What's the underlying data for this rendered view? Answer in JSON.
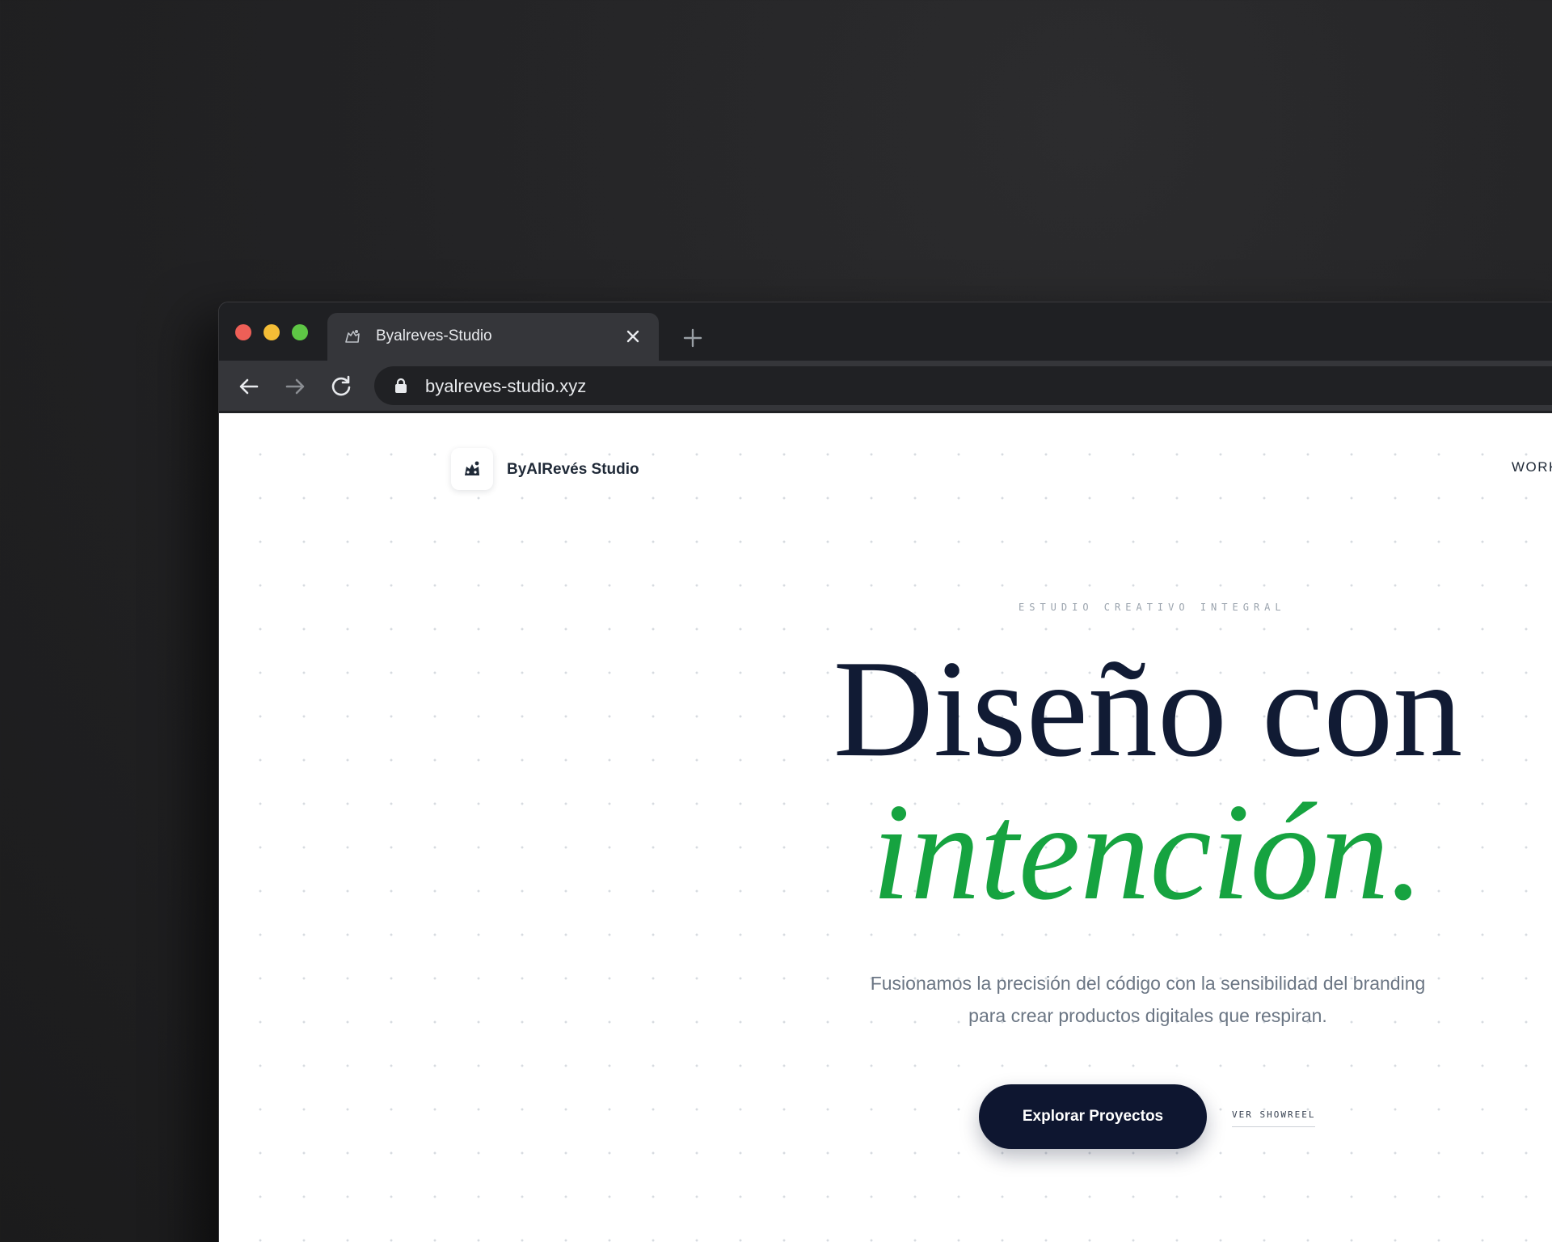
{
  "browser": {
    "tab_title": "Byalreves-Studio",
    "url": "byalreves-studio.xyz"
  },
  "site": {
    "brand_name": "ByAlRevés Studio",
    "nav_link": "WORK",
    "eyebrow": "ESTUDIO CREATIVO INTEGRAL",
    "hero_line1": "Diseño con",
    "hero_line2": "intención.",
    "subtitle_line1": "Fusionamos la precisión del código con la sensibilidad del branding",
    "subtitle_line2": "para crear productos digitales que respiran.",
    "primary_cta": "Explorar Proyectos",
    "secondary_cta": "VER SHOWREEL"
  },
  "colors": {
    "hero_dark": "#111b34",
    "hero_accent": "#16a340",
    "cta_bg": "#0e1630"
  },
  "icons": {
    "traffic_lights": [
      "close-dot",
      "minimize-dot",
      "maximize-dot"
    ],
    "tab": [
      "favicon",
      "close-icon"
    ],
    "toolbar": [
      "back-arrow-icon",
      "forward-arrow-icon",
      "reload-icon",
      "lock-icon",
      "new-tab-plus-icon"
    ]
  }
}
